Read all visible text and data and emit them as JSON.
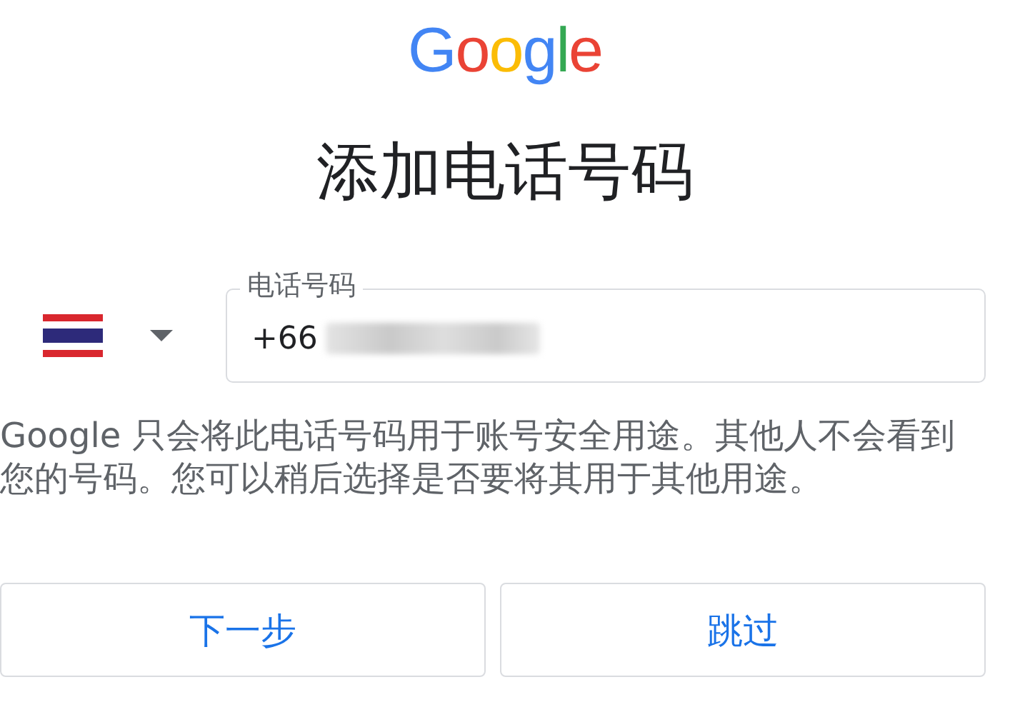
{
  "logo": [
    {
      "letter": "G",
      "color": "#4285f4"
    },
    {
      "letter": "o",
      "color": "#ea4335"
    },
    {
      "letter": "o",
      "color": "#fbbc05"
    },
    {
      "letter": "g",
      "color": "#4285f4"
    },
    {
      "letter": "l",
      "color": "#34a853"
    },
    {
      "letter": "e",
      "color": "#ea4335"
    }
  ],
  "title": "添加电话号码",
  "phone_field": {
    "label": "电话号码",
    "value": "+66"
  },
  "notice": "Google 只会将此电话号码用于账号安全用途。其他人不会看到您的号码。您可以稍后选择是否要将其用于其他用途。",
  "buttons": [
    {
      "label": "下一步"
    },
    {
      "label": "跳过"
    }
  ]
}
